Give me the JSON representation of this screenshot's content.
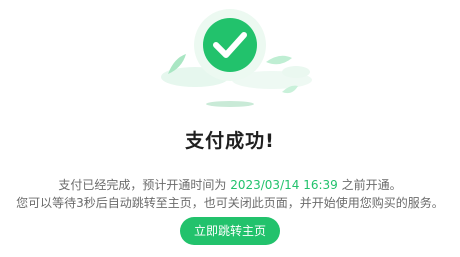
{
  "status": {
    "title": "支付成功!",
    "desc_line1_prefix": "支付已经完成，预计开通时间为 ",
    "open_time": "2023/03/14 16:39",
    "desc_line1_suffix": " 之前开通。",
    "desc_line2": "您可以等待3秒后自动跳转至主页，也可关闭此页面，并开始使用您购买的服务。"
  },
  "actions": {
    "goto_home_label": "立即跳转主页"
  },
  "icons": {
    "success": "check-circle-icon"
  },
  "colors": {
    "accent": "#22c26c",
    "title": "#1f1f1f",
    "text": "#6b6b6b"
  }
}
